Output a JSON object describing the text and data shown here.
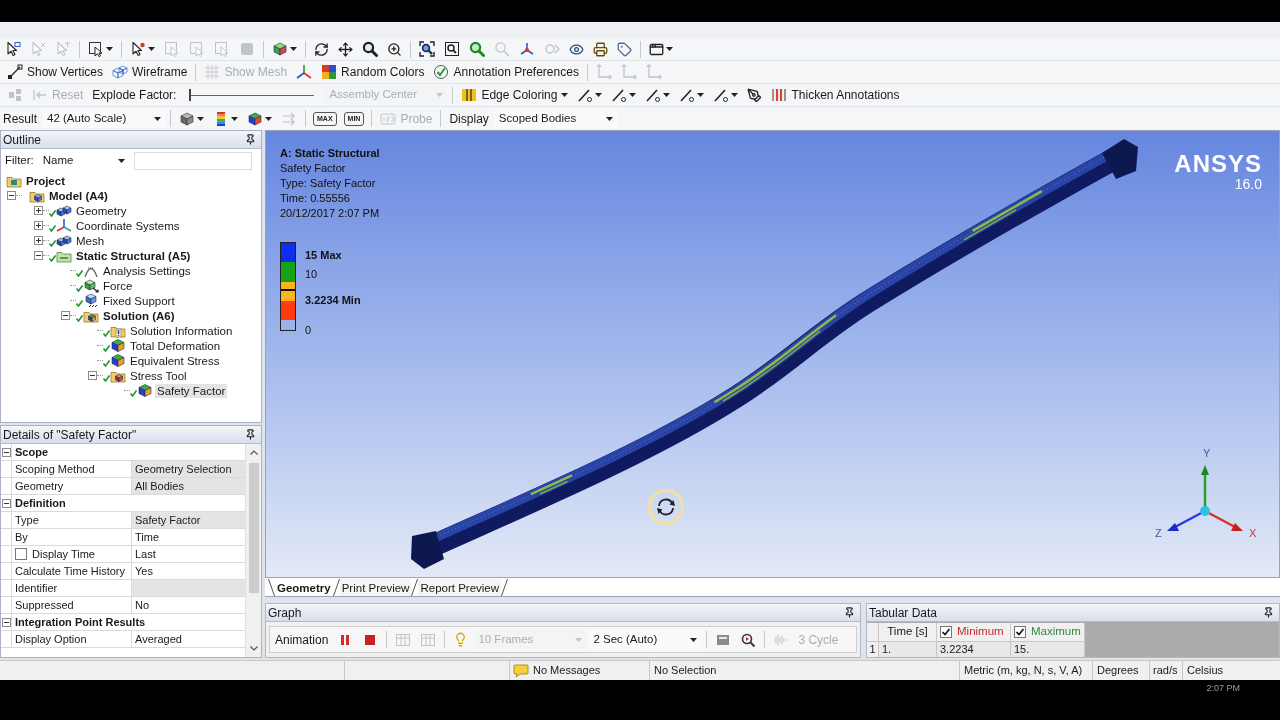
{
  "toolbar_1": {
    "groups": [
      [
        {
          "kind": "icon",
          "disabled": false
        },
        {
          "kind": "icon",
          "disabled": true
        },
        {
          "kind": "icon",
          "disabled": true
        }
      ],
      [
        {
          "kind": "icon",
          "disabled": false,
          "dropdown": true
        }
      ],
      [
        {
          "kind": "icon",
          "disabled": false,
          "dropdown": true
        },
        {
          "kind": "icon",
          "disabled": true
        },
        {
          "kind": "icon",
          "disabled": true
        },
        {
          "kind": "icon",
          "disabled": true
        },
        {
          "kind": "icon",
          "disabled": true
        }
      ],
      [
        {
          "kind": "icon",
          "disabled": false,
          "dropdown": true
        }
      ],
      [
        {
          "kind": "icon",
          "disabled": false
        },
        {
          "kind": "icon",
          "disabled": false
        },
        {
          "kind": "icon",
          "disabled": false
        },
        {
          "kind": "icon",
          "disabled": false
        }
      ],
      [
        {
          "kind": "icon",
          "disabled": false
        },
        {
          "kind": "icon",
          "disabled": false
        },
        {
          "kind": "icon",
          "disabled": false
        },
        {
          "kind": "icon",
          "disabled": true
        },
        {
          "kind": "icon",
          "disabled": false
        },
        {
          "kind": "icon",
          "disabled": true
        },
        {
          "kind": "icon",
          "disabled": false
        },
        {
          "kind": "icon",
          "disabled": false
        },
        {
          "kind": "icon",
          "disabled": false
        }
      ],
      [
        {
          "kind": "icon",
          "disabled": false,
          "dropdown": true
        }
      ]
    ]
  },
  "toolbar_2": {
    "groups": [
      [
        {
          "kind": "button",
          "label": "Show Vertices",
          "disabled": false
        },
        {
          "kind": "button",
          "label": "Wireframe",
          "disabled": false
        }
      ],
      [
        {
          "kind": "button",
          "label": "Show Mesh",
          "disabled": true
        },
        {
          "kind": "icon",
          "disabled": false
        },
        {
          "kind": "button",
          "label": "Random Colors",
          "disabled": false
        },
        {
          "kind": "button",
          "label": "Annotation Preferences",
          "disabled": false
        }
      ],
      [
        {
          "kind": "icon",
          "disabled": true
        },
        {
          "kind": "icon",
          "disabled": true
        },
        {
          "kind": "icon",
          "disabled": true
        }
      ]
    ]
  },
  "toolbar_3": {
    "groups": [
      [
        {
          "kind": "icon",
          "disabled": true
        },
        {
          "kind": "button",
          "label": "Reset",
          "disabled": true
        },
        {
          "kind": "label",
          "text": "Explode Factor:"
        },
        {
          "kind": "slider",
          "level": 0
        },
        {
          "kind": "select",
          "value": "Assembly Center",
          "disabled": true
        }
      ],
      [
        {
          "kind": "button",
          "label": "Edge Coloring",
          "disabled": false,
          "dropdown": true
        },
        {
          "kind": "icon",
          "disabled": false,
          "dropdown": true
        },
        {
          "kind": "icon",
          "disabled": false,
          "dropdown": true
        },
        {
          "kind": "icon",
          "disabled": false,
          "dropdown": true
        },
        {
          "kind": "icon",
          "disabled": false,
          "dropdown": true
        },
        {
          "kind": "icon",
          "disabled": false,
          "dropdown": true
        },
        {
          "kind": "icon",
          "disabled": false
        },
        {
          "kind": "button",
          "label": "Thicken Annotations",
          "disabled": false
        }
      ]
    ]
  },
  "toolbar_4": {
    "groups": [
      [
        {
          "kind": "label",
          "text": "Result"
        },
        {
          "kind": "select",
          "value": "42 (Auto Scale)",
          "disabled": false
        }
      ],
      [
        {
          "kind": "icon",
          "disabled": false,
          "dropdown": true
        },
        {
          "kind": "icon",
          "disabled": false,
          "dropdown": true
        },
        {
          "kind": "icon",
          "disabled": false,
          "dropdown": true
        },
        {
          "kind": "icon",
          "disabled": true
        }
      ],
      [
        {
          "kind": "tag_button",
          "label": "MAX",
          "disabled": false
        },
        {
          "kind": "tag_button",
          "label": "MIN",
          "disabled": false
        }
      ],
      [
        {
          "kind": "button",
          "label": "Probe",
          "disabled": true
        }
      ],
      [
        {
          "kind": "label",
          "text": "Display"
        },
        {
          "kind": "select",
          "value": "Scoped Bodies",
          "disabled": false
        }
      ]
    ]
  },
  "outline": {
    "title": "Outline",
    "filter": {
      "label": "Filter:",
      "value": "Name"
    },
    "tree": [
      {
        "label": "Project",
        "kind": "project",
        "bold": true,
        "checkmark": false,
        "selected": false,
        "children": [
          {
            "label": "Model (A4)",
            "kind": "model",
            "bold": true,
            "checkmark": false,
            "selected": false,
            "expanded": true,
            "children": [
              {
                "label": "Geometry",
                "kind": "geometry",
                "bold": false,
                "checkmark": true,
                "selected": false,
                "expanded": false
              },
              {
                "label": "Coordinate Systems",
                "kind": "coordinate_systems",
                "bold": false,
                "checkmark": true,
                "selected": false,
                "expanded": false
              },
              {
                "label": "Mesh",
                "kind": "mesh",
                "bold": false,
                "checkmark": true,
                "selected": false,
                "expanded": false
              },
              {
                "label": "Static Structural (A5)",
                "kind": "static_structural",
                "bold": true,
                "checkmark": true,
                "selected": false,
                "expanded": true,
                "children": [
                  {
                    "label": "Analysis Settings",
                    "kind": "analysis_settings",
                    "bold": false,
                    "checkmark": true,
                    "selected": false
                  },
                  {
                    "label": "Force",
                    "kind": "force",
                    "bold": false,
                    "checkmark": true,
                    "selected": false
                  },
                  {
                    "label": "Fixed Support",
                    "kind": "fixed_support",
                    "bold": false,
                    "checkmark": true,
                    "selected": false
                  },
                  {
                    "label": "Solution (A6)",
                    "kind": "solution",
                    "bold": true,
                    "checkmark": true,
                    "selected": false,
                    "expanded": true,
                    "children": [
                      {
                        "label": "Solution Information",
                        "kind": "solution_information",
                        "bold": false,
                        "checkmark": true,
                        "selected": false
                      },
                      {
                        "label": "Total Deformation",
                        "kind": "result",
                        "bold": false,
                        "checkmark": true,
                        "selected": false
                      },
                      {
                        "label": "Equivalent Stress",
                        "kind": "result",
                        "bold": false,
                        "checkmark": true,
                        "selected": false
                      },
                      {
                        "label": "Stress Tool",
                        "kind": "stress_tool",
                        "bold": false,
                        "checkmark": true,
                        "selected": false,
                        "expanded": true,
                        "children": [
                          {
                            "label": "Safety Factor",
                            "kind": "result",
                            "bold": false,
                            "checkmark": true,
                            "selected": true
                          }
                        ]
                      }
                    ]
                  }
                ]
              }
            ]
          }
        ]
      }
    ]
  },
  "details": {
    "title": "Details of \"Safety Factor\"",
    "rows": [
      {
        "kind": "section",
        "label": "Scope",
        "expanded": true
      },
      {
        "kind": "property",
        "label": "Scoping Method",
        "value": "Geometry Selection",
        "highlighted": true
      },
      {
        "kind": "property",
        "label": "Geometry",
        "value": "All Bodies",
        "highlighted": true
      },
      {
        "kind": "section",
        "label": "Definition",
        "expanded": true
      },
      {
        "kind": "property",
        "label": "Type",
        "value": "Safety Factor",
        "highlighted": true
      },
      {
        "kind": "property",
        "label": "By",
        "value": "Time",
        "highlighted": false
      },
      {
        "kind": "checkbox_property",
        "label": "Display Time",
        "checked": false,
        "value": "Last",
        "highlighted": false
      },
      {
        "kind": "property",
        "label": "Calculate Time History",
        "value": "Yes",
        "highlighted": false
      },
      {
        "kind": "property",
        "label": "Identifier",
        "highlighted": true
      },
      {
        "kind": "property",
        "label": "Suppressed",
        "value": "No",
        "highlighted": false
      },
      {
        "kind": "section",
        "label": "Integration Point Results",
        "expanded": true
      },
      {
        "kind": "property",
        "label": "Display Option",
        "value": "Averaged",
        "highlighted": false
      }
    ]
  },
  "viewport": {
    "title": "A: Static Structural",
    "lines": [
      "Safety Factor",
      "Type: Safety Factor",
      "Time: 0.55556",
      "20/12/2017 2:07 PM"
    ],
    "legend": {
      "bands": [
        {
          "color": "#0b2ef0"
        },
        {
          "color": "#16a316"
        },
        {
          "color": "#ffb31a"
        },
        {
          "color": "#ffb31a"
        },
        {
          "color": "#ff3b0f"
        }
      ],
      "labels": [
        {
          "text": "15 Max",
          "kind": "max"
        },
        {
          "text": "10",
          "kind": "value"
        },
        {
          "text": "3.2234 Min",
          "kind": "min"
        },
        {
          "text": "0",
          "kind": "value"
        }
      ]
    },
    "logo": {
      "name": "ANSYS",
      "version": "16.0"
    },
    "triad": {
      "y": "Y",
      "z": "Z",
      "x": "X"
    }
  },
  "view_tabs": [
    {
      "label": "Geometry",
      "selected": true
    },
    {
      "label": "Print Preview",
      "selected": false
    },
    {
      "label": "Report Preview",
      "selected": false
    }
  ],
  "graph": {
    "title": "Graph",
    "toolbar": {
      "groups": [
        [
          {
            "kind": "label",
            "text": "Animation"
          },
          {
            "kind": "icon",
            "disabled": false
          },
          {
            "kind": "icon",
            "disabled": false
          }
        ],
        [
          {
            "kind": "icon",
            "disabled": true
          },
          {
            "kind": "icon",
            "disabled": true
          }
        ],
        [
          {
            "kind": "icon",
            "disabled": false
          },
          {
            "kind": "select",
            "value": "10 Frames",
            "disabled": true
          },
          {
            "kind": "select",
            "value": "2 Sec (Auto)",
            "disabled": false
          }
        ],
        [
          {
            "kind": "icon",
            "disabled": false
          },
          {
            "kind": "icon",
            "disabled": false
          }
        ],
        [
          {
            "kind": "icon",
            "disabled": true
          },
          {
            "kind": "label",
            "text": "3 Cycle",
            "disabled": true
          }
        ]
      ]
    }
  },
  "tabular_data": {
    "title": "Tabular Data",
    "columns": [
      {
        "label": "Time [s]"
      },
      {
        "label": "Minimum",
        "checked": true,
        "color": "#c8282d"
      },
      {
        "label": "Maximum",
        "checked": true,
        "color": "#2e8b3a"
      }
    ],
    "rows": [
      {
        "index": "1",
        "cells": [
          "1.",
          "3.2234",
          "15."
        ]
      }
    ]
  },
  "status_bar": {
    "messages": "No Messages",
    "selection": "No Selection",
    "units": "Metric (m, kg, N, s, V, A)",
    "angle": "Degrees",
    "rotational_velocity": "rad/s",
    "temperature": "Celsius"
  },
  "taskbar": {
    "clock": "2:07 PM"
  }
}
